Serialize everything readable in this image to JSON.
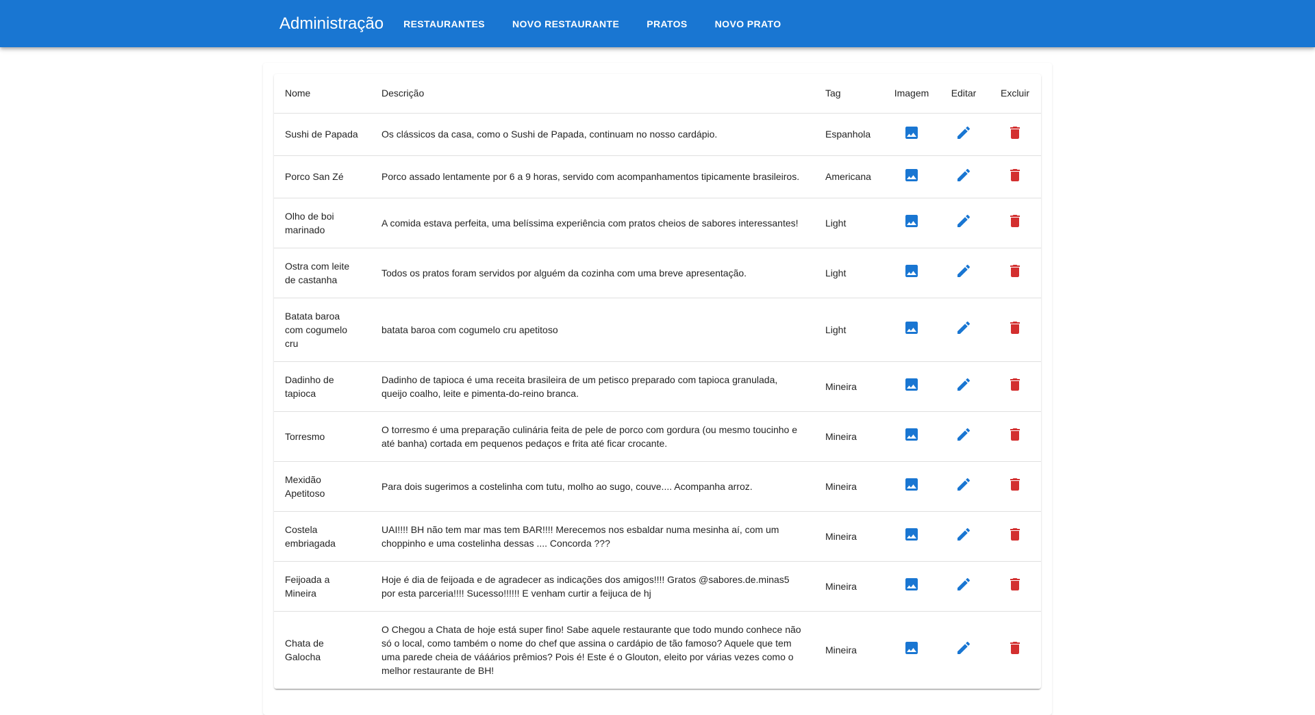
{
  "header": {
    "title": "Administração",
    "nav": [
      {
        "label": "RESTAURANTES"
      },
      {
        "label": "NOVO RESTAURANTE"
      },
      {
        "label": "PRATOS"
      },
      {
        "label": "NOVO PRATO"
      }
    ]
  },
  "colors": {
    "primary": "#1976d2",
    "danger": "#d32f2f"
  },
  "icons": {
    "image": "image-icon",
    "edit": "pencil-icon",
    "delete": "trash-icon"
  },
  "table": {
    "columns": {
      "nome": "Nome",
      "descricao": "Descrição",
      "tag": "Tag",
      "imagem": "Imagem",
      "editar": "Editar",
      "excluir": "Excluir"
    },
    "rows": [
      {
        "nome": "Sushi de Papada",
        "descricao": "Os clássicos da casa, como o Sushi de Papada, continuam no nosso cardápio.",
        "tag": "Espanhola"
      },
      {
        "nome": "Porco San Zé",
        "descricao": "Porco assado lentamente por 6 a 9 horas, servido com acompanhamentos tipicamente brasileiros.",
        "tag": "Americana"
      },
      {
        "nome": "Olho de boi marinado",
        "descricao": "A comida estava perfeita, uma belíssima experiência com pratos cheios de sabores interessantes!",
        "tag": "Light"
      },
      {
        "nome": "Ostra com leite de castanha",
        "descricao": "Todos os pratos foram servidos por alguém da cozinha com uma breve apresentação.",
        "tag": "Light"
      },
      {
        "nome": "Batata baroa com cogumelo cru",
        "descricao": "batata baroa com cogumelo cru apetitoso",
        "tag": "Light"
      },
      {
        "nome": "Dadinho de tapioca",
        "descricao": "Dadinho de tapioca é uma receita brasileira de um petisco preparado com tapioca granulada, queijo coalho, leite e pimenta-do-reino branca.",
        "tag": "Mineira"
      },
      {
        "nome": "Torresmo",
        "descricao": "O torresmo é uma preparação culinária feita de pele de porco com gordura (ou mesmo toucinho e até banha) cortada em pequenos pedaços e frita até ficar crocante.",
        "tag": "Mineira"
      },
      {
        "nome": "Mexidão Apetitoso",
        "descricao": "Para dois sugerimos a costelinha com tutu, molho ao sugo, couve.... Acompanha arroz.",
        "tag": "Mineira"
      },
      {
        "nome": "Costela embriagada",
        "descricao": "UAI!!!! BH não tem mar mas tem BAR!!!! Merecemos nos esbaldar numa mesinha aí, com um choppinho e uma costelinha dessas .... Concorda ???",
        "tag": "Mineira"
      },
      {
        "nome": "Feijoada a Mineira",
        "descricao": "Hoje é dia de feijoada e de agradecer as indicações dos amigos!!!! Gratos @sabores.de.minas5 por esta parceria!!!! Sucesso!!!!!! E venham curtir a feijuca de hj",
        "tag": "Mineira"
      },
      {
        "nome": "Chata de Galocha",
        "descricao": "O Chegou a Chata de hoje está super fino! Sabe aquele restaurante que todo mundo conhece não só o local, como também o nome do chef que assina o cardápio de tão famoso? Aquele que tem uma parede cheia de vááários prêmios? Pois é! Este é o Glouton, eleito por várias vezes como o melhor restaurante de BH!",
        "tag": "Mineira"
      }
    ]
  }
}
